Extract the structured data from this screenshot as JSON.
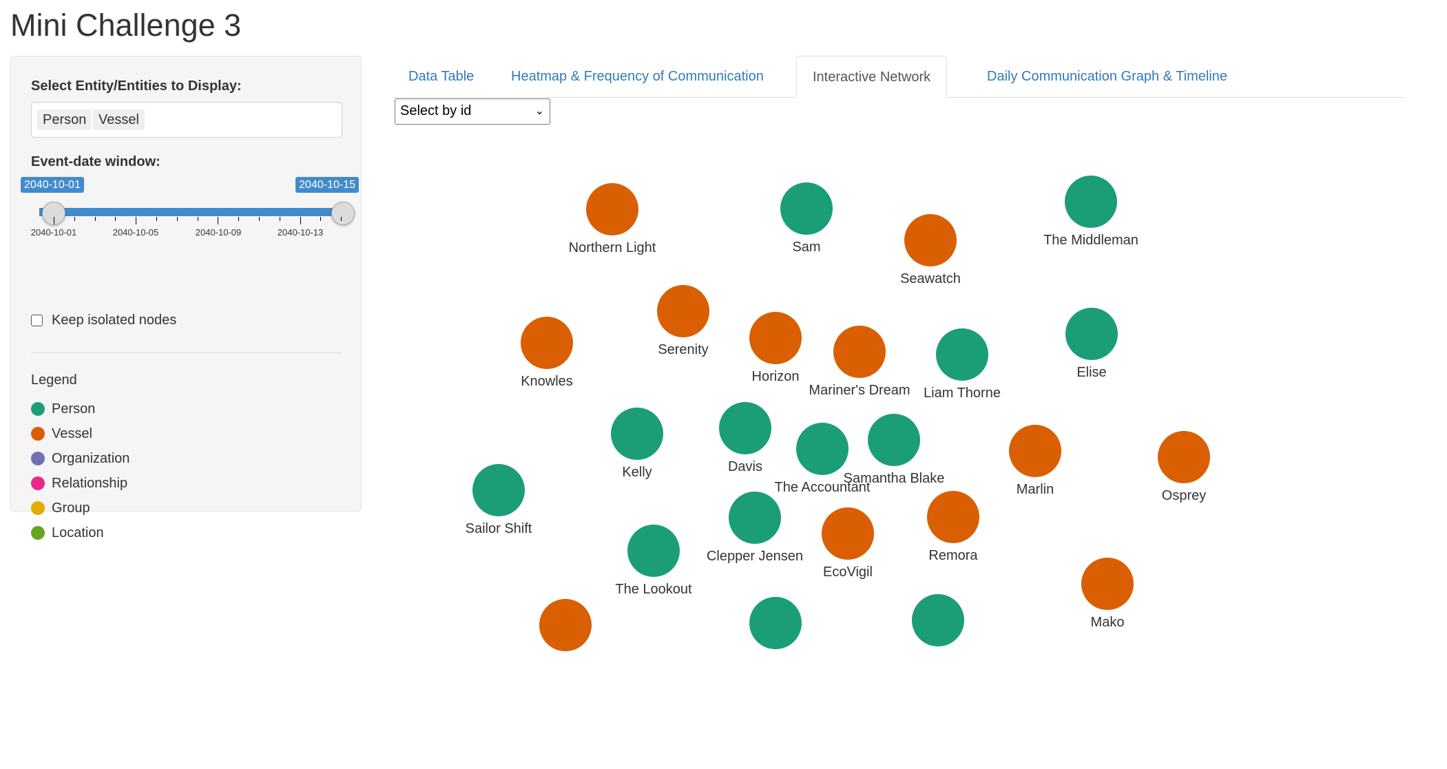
{
  "app": {
    "title": "Mini Challenge 3"
  },
  "sidebar": {
    "entity_label": "Select Entity/Entities to Display:",
    "selected_entities": [
      "Person",
      "Vessel"
    ],
    "date_label": "Event-date window:",
    "date_start": "2040-10-01",
    "date_end": "2040-10-15",
    "tick_labels": [
      "2040-10-01",
      "2040-10-05",
      "2040-10-09",
      "2040-10-13"
    ],
    "keep_isolated_label": "Keep isolated nodes",
    "keep_isolated_checked": false,
    "legend_title": "Legend",
    "legend": [
      {
        "label": "Person",
        "color": "#1b9e77"
      },
      {
        "label": "Vessel",
        "color": "#d95f02"
      },
      {
        "label": "Organization",
        "color": "#7570b3"
      },
      {
        "label": "Relationship",
        "color": "#e7298a"
      },
      {
        "label": "Group",
        "color": "#e6ab02"
      },
      {
        "label": "Location",
        "color": "#66a61e"
      }
    ]
  },
  "tabs": [
    {
      "label": "Data Table",
      "active": false
    },
    {
      "label": "Heatmap & Frequency of Communication",
      "active": false
    },
    {
      "label": "Interactive Network",
      "active": true
    },
    {
      "label": "Daily Communication Graph & Timeline",
      "active": false
    }
  ],
  "network": {
    "select_value": "Select by id",
    "colors": {
      "Person": "#1b9e77",
      "Vessel": "#d95f02"
    },
    "nodes": [
      {
        "label": "Northern Light",
        "type": "Vessel"
      },
      {
        "label": "Sam",
        "type": "Person"
      },
      {
        "label": "The Middleman",
        "type": "Person"
      },
      {
        "label": "Seawatch",
        "type": "Vessel"
      },
      {
        "label": "Serenity",
        "type": "Vessel"
      },
      {
        "label": "Knowles",
        "type": "Vessel"
      },
      {
        "label": "Horizon",
        "type": "Vessel"
      },
      {
        "label": "Mariner's Dream",
        "type": "Vessel"
      },
      {
        "label": "Liam Thorne",
        "type": "Person"
      },
      {
        "label": "Elise",
        "type": "Person"
      },
      {
        "label": "Kelly",
        "type": "Person"
      },
      {
        "label": "Davis",
        "type": "Person"
      },
      {
        "label": "The Accountant",
        "type": "Person"
      },
      {
        "label": "Samantha Blake",
        "type": "Person"
      },
      {
        "label": "Marlin",
        "type": "Vessel"
      },
      {
        "label": "Osprey",
        "type": "Vessel"
      },
      {
        "label": "Sailor Shift",
        "type": "Person"
      },
      {
        "label": "Clepper Jensen",
        "type": "Person"
      },
      {
        "label": "EcoVigil",
        "type": "Vessel"
      },
      {
        "label": "Remora",
        "type": "Vessel"
      },
      {
        "label": "The Lookout",
        "type": "Person"
      },
      {
        "label": "Mako",
        "type": "Vessel"
      },
      {
        "label": "",
        "type": "Vessel"
      },
      {
        "label": "",
        "type": "Person"
      },
      {
        "label": "",
        "type": "Person"
      }
    ]
  }
}
